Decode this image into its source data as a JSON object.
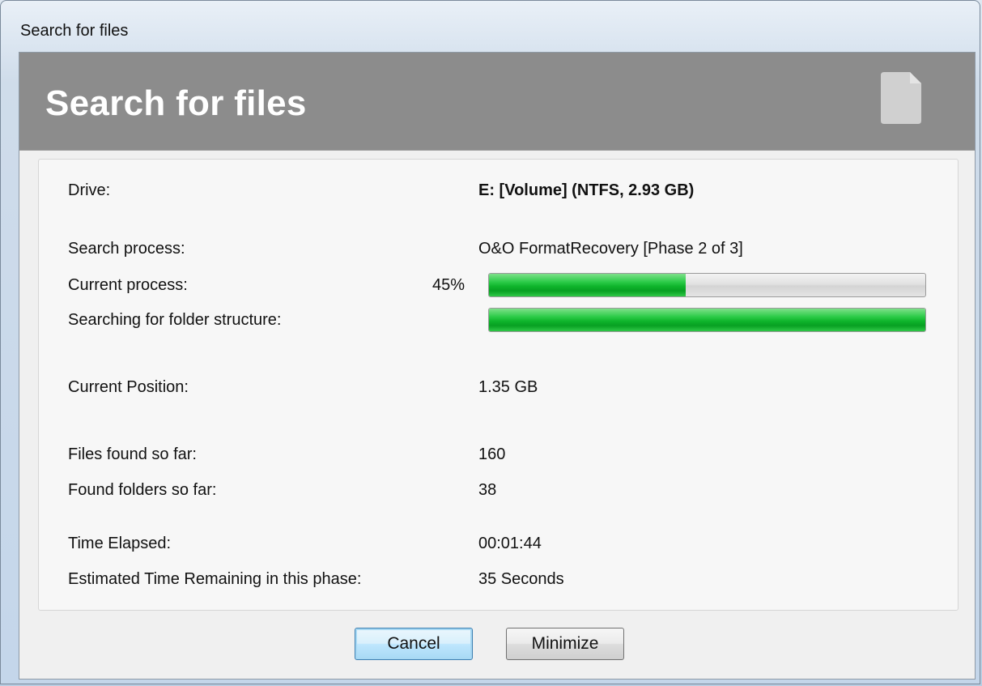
{
  "window": {
    "title": "Search for files"
  },
  "banner": {
    "title": "Search for files",
    "icon": "document-icon"
  },
  "drive": {
    "label": "Drive:",
    "value": "E: [Volume] (NTFS, 2.93 GB)"
  },
  "search_process": {
    "label": "Search process:",
    "value": "O&O FormatRecovery [Phase 2 of 3]"
  },
  "current_process": {
    "label": "Current process:",
    "percent_text": "45%",
    "progress": 0.45
  },
  "folder_structure": {
    "label": "Searching for folder structure:",
    "progress": 1.0
  },
  "current_position": {
    "label": "Current Position:",
    "value": "1.35 GB"
  },
  "files_found": {
    "label": "Files found so far:",
    "value": "160"
  },
  "folders_found": {
    "label": "Found folders so far:",
    "value": "38"
  },
  "time_elapsed": {
    "label": "Time Elapsed:",
    "value": "00:01:44"
  },
  "time_remaining": {
    "label": "Estimated Time Remaining in this phase:",
    "value": "35 Seconds"
  },
  "buttons": {
    "cancel": "Cancel",
    "minimize": "Minimize"
  },
  "colors": {
    "banner": "#8c8c8c",
    "progress_green": "#0fb52c",
    "default_button_border": "#3c7fb1"
  }
}
